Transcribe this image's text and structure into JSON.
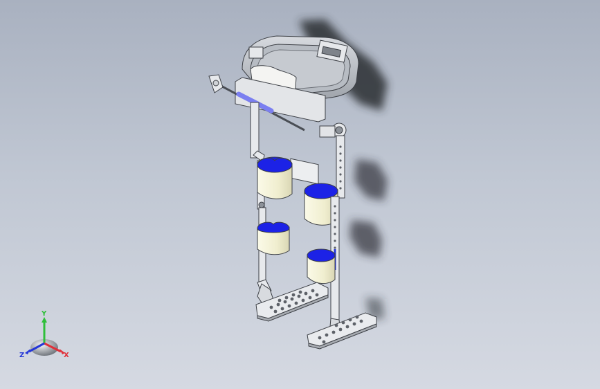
{
  "viewport": {
    "background_top": "#a9b1c0",
    "background_bottom": "#d5d9e2",
    "model": "exoskeleton-assembly"
  },
  "colors": {
    "metal": "#e7e9ec",
    "metal_dark": "#8d9299",
    "cuff_outer": "#f2f0d6",
    "cuff_inner": "#1c22e6",
    "rod": "#7b7ff0",
    "shadow": "#2a2d33"
  },
  "triad": {
    "x_label": "X",
    "y_label": "Y",
    "z_label": "Z",
    "x_color": "#e0303a",
    "y_color": "#2fbf3a",
    "z_color": "#2436d8"
  }
}
